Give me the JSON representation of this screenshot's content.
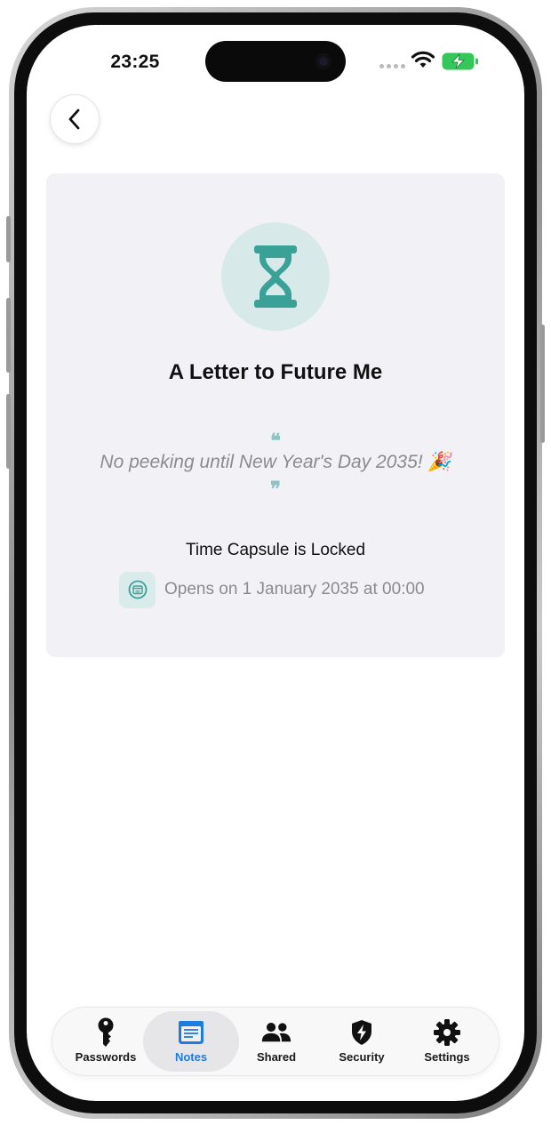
{
  "status_bar": {
    "time": "23:25"
  },
  "note": {
    "title": "A Letter to Future Me",
    "quote": "No peeking until New Year's Day 2035! 🎉",
    "quote_open_mark": "❝",
    "quote_close_mark": "❞",
    "lock_status": "Time Capsule is Locked",
    "opens_text": "Opens on 1 January 2035 at 00:00"
  },
  "tabs": [
    {
      "label": "Passwords",
      "icon": "key-icon",
      "active": false
    },
    {
      "label": "Notes",
      "icon": "notes-icon",
      "active": true
    },
    {
      "label": "Shared",
      "icon": "people-icon",
      "active": false
    },
    {
      "label": "Security",
      "icon": "shield-bolt-icon",
      "active": false
    },
    {
      "label": "Settings",
      "icon": "gear-icon",
      "active": false
    }
  ],
  "colors": {
    "accent": "#1e7be0",
    "teal": "#3aa197",
    "teal_light": "#d8e9ea",
    "card_bg": "#f2f2f6",
    "battery": "#34c759"
  }
}
